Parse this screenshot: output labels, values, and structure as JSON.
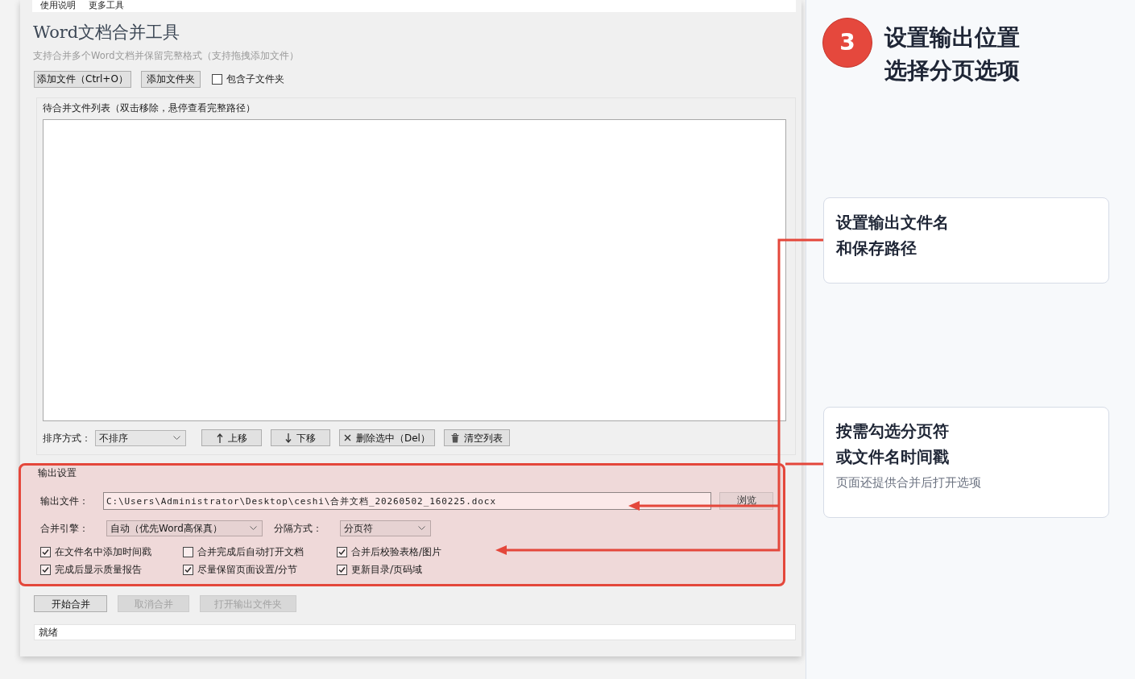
{
  "menu_bar": {
    "items": [
      "使用说明",
      "更多工具"
    ]
  },
  "app": {
    "title": "Word文档合并工具",
    "subtitle": "支持合并多个Word文档并保留完整格式（支持拖拽添加文件）",
    "toolbar": {
      "buttons": [
        "添加文件（Ctrl+O）",
        "添加文件夹"
      ],
      "checkbox": {
        "label": "包含子文件夹",
        "checked": false
      }
    },
    "file_list": {
      "title": "待合并文件列表（双击移除，悬停查看完整路径）",
      "sort": {
        "label": "排序方式：",
        "value": "不排序"
      },
      "buttons": [
        {
          "kind": "up",
          "label": "上移"
        },
        {
          "kind": "down",
          "label": "下移"
        },
        {
          "kind": "remove",
          "label": "删除选中（Del）"
        },
        {
          "kind": "clear",
          "label": "清空列表"
        }
      ]
    },
    "output_settings": {
      "title": "输出设置",
      "highlighted": true,
      "output_file": {
        "label": "输出文件：",
        "value": "C:\\Users\\Administrator\\Desktop\\ceshi\\合并文档_20260502_160225.docx"
      },
      "browse_button": "浏览",
      "engine": {
        "label": "合并引擎：",
        "value": "自动（优先Word高保真）"
      },
      "separator": {
        "label": "分隔方式：",
        "value": "分页符"
      },
      "options": [
        {
          "label": "在文件名中添加时间戳",
          "checked": true
        },
        {
          "label": "合并完成后自动打开文档",
          "checked": false
        },
        {
          "label": "合并后校验表格/图片",
          "checked": true
        },
        {
          "label": "完成后显示质量报告",
          "checked": true
        },
        {
          "label": "尽量保留页面设置/分节",
          "checked": true
        },
        {
          "label": "更新目录/页码域",
          "checked": true
        }
      ]
    },
    "actions": [
      {
        "label": "开始合并",
        "disabled": false
      },
      {
        "label": "取消合并",
        "disabled": true
      },
      {
        "label": "打开输出文件夹",
        "disabled": true
      }
    ],
    "status_bar": "就绪"
  },
  "guide": {
    "step": "3",
    "title_lines": [
      "设置输出位置",
      "选择分页选项"
    ],
    "cards": [
      {
        "title_lines": [
          "设置输出文件名",
          "和保存路径"
        ]
      },
      {
        "title_lines": [
          "按需勾选分页符",
          "或文件名时间戳"
        ],
        "note": "页面还提供合并后打开选项"
      }
    ]
  }
}
